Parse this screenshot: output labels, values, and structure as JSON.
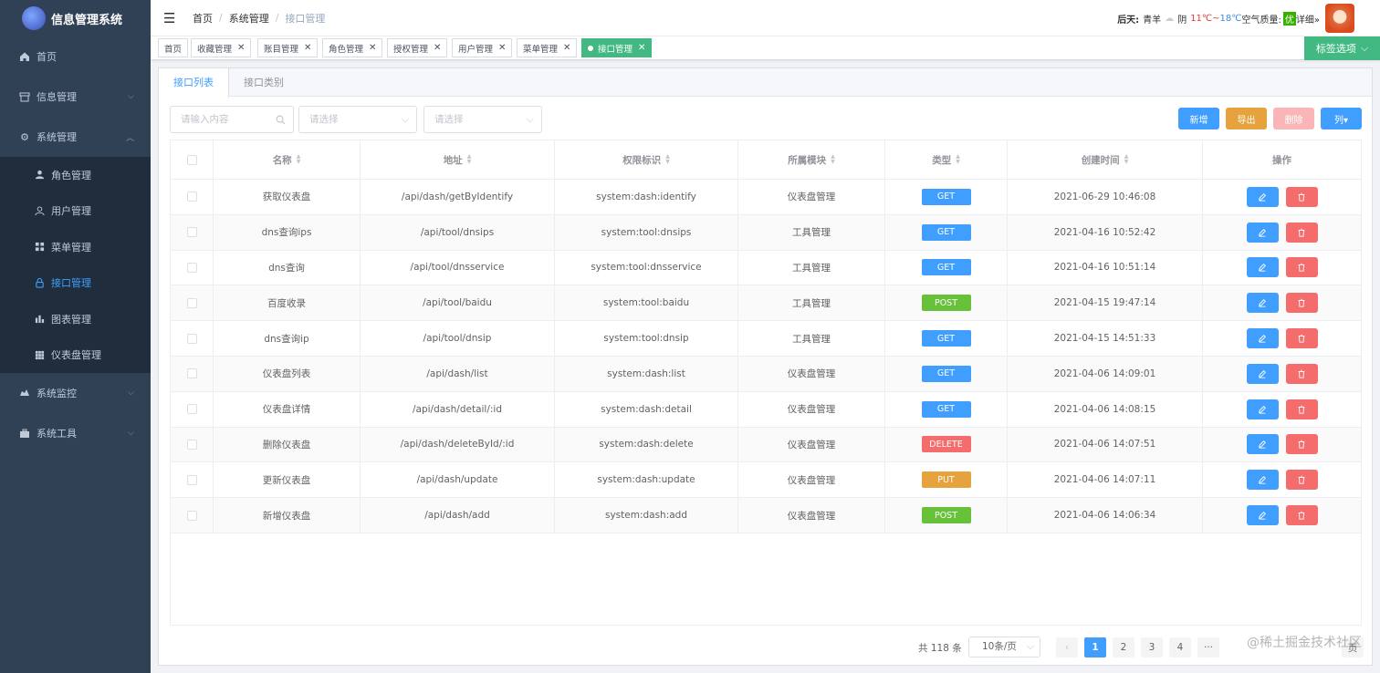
{
  "app": {
    "title": "信息管理系统"
  },
  "sidebar": {
    "items": [
      {
        "label": "首页",
        "icon": "home-icon"
      },
      {
        "label": "信息管理",
        "icon": "archive-icon"
      },
      {
        "label": "系统管理",
        "icon": "gear-icon"
      }
    ],
    "sub": [
      {
        "label": "角色管理",
        "icon": "user-icon"
      },
      {
        "label": "用户管理",
        "icon": "user-outline-icon"
      },
      {
        "label": "菜单管理",
        "icon": "grid-icon"
      },
      {
        "label": "接口管理",
        "icon": "lock-icon",
        "active": true
      },
      {
        "label": "图表管理",
        "icon": "bar-chart-icon"
      },
      {
        "label": "仪表盘管理",
        "icon": "dashboard-grid-icon"
      }
    ],
    "bottom": [
      {
        "label": "系统监控",
        "icon": "monitor-icon"
      },
      {
        "label": "系统工具",
        "icon": "toolbox-icon"
      }
    ]
  },
  "breadcrumb": [
    "首页",
    "系统管理",
    "接口管理"
  ],
  "weather": {
    "day": "后天:",
    "city": "青羊",
    "cond": "阴",
    "hi": "11℃~",
    "lo": "18℃",
    "aqi_label": "空气质量:",
    "aqi": "优",
    "detail": "详细»"
  },
  "tags": [
    "首页",
    "收藏管理",
    "账目管理",
    "角色管理",
    "授权管理",
    "用户管理",
    "菜单管理",
    "接口管理"
  ],
  "tag_options": "标签选项",
  "tabs": [
    "接口列表",
    "接口类别"
  ],
  "filters": {
    "search_placeholder": "请输入内容",
    "select1": "请选择",
    "select2": "请选择"
  },
  "buttons": {
    "add": "新增",
    "export": "导出",
    "delete": "删除",
    "columns": "列▾"
  },
  "table": {
    "headers": [
      "名称",
      "地址",
      "权限标识",
      "所属模块",
      "类型",
      "创建时间",
      "操作"
    ],
    "rows": [
      {
        "name": "获取仪表盘",
        "addr": "/api/dash/getByIdentify",
        "perm": "system:dash:identify",
        "module": "仪表盘管理",
        "type": "GET",
        "time": "2021-06-29 10:46:08"
      },
      {
        "name": "dns查询ips",
        "addr": "/api/tool/dnsips",
        "perm": "system:tool:dnsips",
        "module": "工具管理",
        "type": "GET",
        "time": "2021-04-16 10:52:42"
      },
      {
        "name": "dns查询",
        "addr": "/api/tool/dnsservice",
        "perm": "system:tool:dnsservice",
        "module": "工具管理",
        "type": "GET",
        "time": "2021-04-16 10:51:14"
      },
      {
        "name": "百度收录",
        "addr": "/api/tool/baidu",
        "perm": "system:tool:baidu",
        "module": "工具管理",
        "type": "POST",
        "time": "2021-04-15 19:47:14"
      },
      {
        "name": "dns查询ip",
        "addr": "/api/tool/dnsip",
        "perm": "system:tool:dnsip",
        "module": "工具管理",
        "type": "GET",
        "time": "2021-04-15 14:51:33"
      },
      {
        "name": "仪表盘列表",
        "addr": "/api/dash/list",
        "perm": "system:dash:list",
        "module": "仪表盘管理",
        "type": "GET",
        "time": "2021-04-06 14:09:01"
      },
      {
        "name": "仪表盘详情",
        "addr": "/api/dash/detail/:id",
        "perm": "system:dash:detail",
        "module": "仪表盘管理",
        "type": "GET",
        "time": "2021-04-06 14:08:15"
      },
      {
        "name": "删除仪表盘",
        "addr": "/api/dash/deleteById/:id",
        "perm": "system:dash:delete",
        "module": "仪表盘管理",
        "type": "DELETE",
        "time": "2021-04-06 14:07:51"
      },
      {
        "name": "更新仪表盘",
        "addr": "/api/dash/update",
        "perm": "system:dash:update",
        "module": "仪表盘管理",
        "type": "PUT",
        "time": "2021-04-06 14:07:11"
      },
      {
        "name": "新增仪表盘",
        "addr": "/api/dash/add",
        "perm": "system:dash:add",
        "module": "仪表盘管理",
        "type": "POST",
        "time": "2021-04-06 14:06:34"
      }
    ]
  },
  "type_colors": {
    "GET": "#409eff",
    "POST": "#67c23a",
    "DELETE": "#f56c6c",
    "PUT": "#e6a23c"
  },
  "pagination": {
    "total": "共 118 条",
    "size": "10条/页",
    "pages": [
      "1",
      "2",
      "3",
      "4"
    ],
    "more": "···",
    "next": "页"
  },
  "watermark": "@稀土掘金技术社区"
}
